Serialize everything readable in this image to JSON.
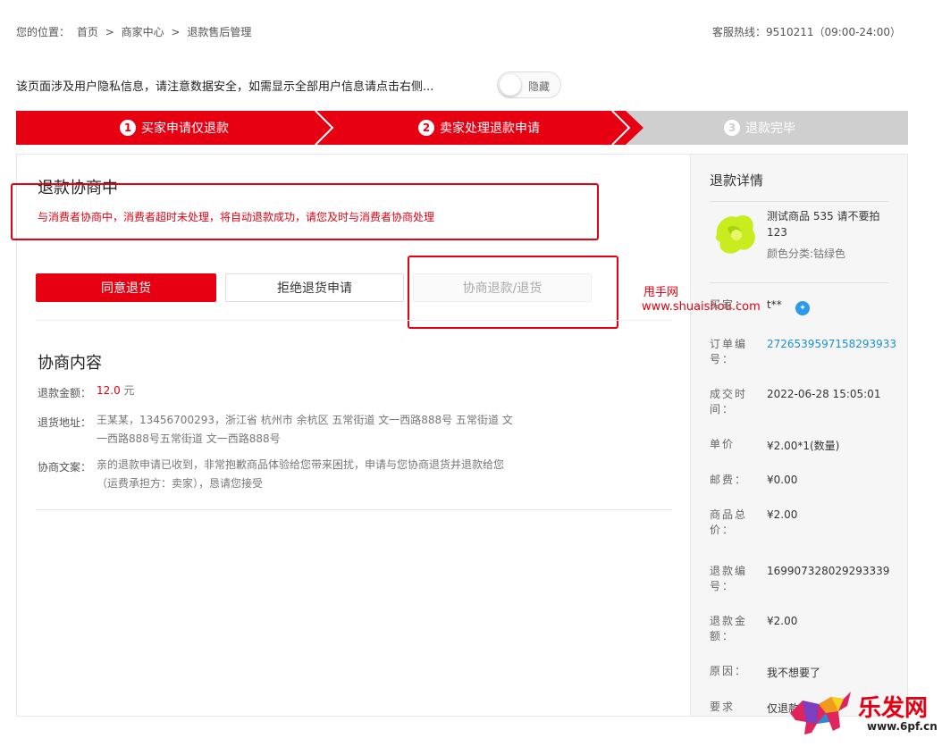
{
  "breadcrumb": {
    "prefix": "您的位置：",
    "items": [
      "首页",
      ">",
      "商家中心",
      ">",
      "退款售后管理"
    ]
  },
  "hotline": "客服热线：9510211（09:00-24:00）",
  "privacy": {
    "notice": "该页面涉及用户隐私信息，请注意数据安全，如需显示全部用户信息请点击右侧...",
    "toggle_label": "隐藏"
  },
  "steps": [
    {
      "num": "1",
      "label": "买家申请仅退款"
    },
    {
      "num": "2",
      "label": "卖家处理退款申请"
    },
    {
      "num": "3",
      "label": "退款完毕"
    }
  ],
  "negotiation": {
    "title": "退款协商中",
    "message": "与消费者协商中，消费者超时未处理，将自动退款成功，请您及时与消费者协商处理"
  },
  "actions": {
    "agree": "同意退货",
    "reject": "拒绝退货申请",
    "negotiate": "协商退款/退货"
  },
  "watermark": {
    "line1": "甩手网",
    "line2": "www.shuaishou.com"
  },
  "content": {
    "title": "协商内容",
    "amount_label": "退款金额：",
    "amount_value": "12.0",
    "amount_unit": "元",
    "address_label": "退货地址：",
    "address_value": "王某某，13456700293，浙江省 杭州市 余杭区 五常街道 文一西路888号 五常街道 文一西路888号五常街道 文一西路888号",
    "text_label": "协商文案：",
    "text_value": "亲的退款申请已收到，非常抱歉商品体验给您带来困扰，申请与您协商退货并退款给您（运费承担方：卖家），恳请您接受"
  },
  "details": {
    "title": "退款详情",
    "product_name": "测试商品 535 请不要拍 123",
    "product_attr": "颜色分类:钴绿色",
    "rows": [
      {
        "label": "买家：",
        "value": "t**"
      },
      {
        "label": "订单编号：",
        "value": "2726539597158293933"
      },
      {
        "label": "成交时间：",
        "value": "2022-06-28 15:05:01"
      },
      {
        "label": "单价",
        "value": "¥2.00*1(数量)"
      },
      {
        "label": "邮费：",
        "value": "¥0.00"
      },
      {
        "label": "商品总价：",
        "value": "¥2.00"
      },
      {
        "label": "退款编号：",
        "value": "169907328029293339"
      },
      {
        "label": "退款金额：",
        "value": "¥2.00"
      },
      {
        "label": "原因：",
        "value": "我不想要了"
      },
      {
        "label": "要求",
        "value": "仅退款"
      }
    ]
  },
  "logo": {
    "text": "乐发网",
    "url": "www.6pf.cn"
  },
  "colors": {
    "accent": "#e60012",
    "link": "#1a8fd6",
    "step_inactive": "#cfcfcf"
  }
}
